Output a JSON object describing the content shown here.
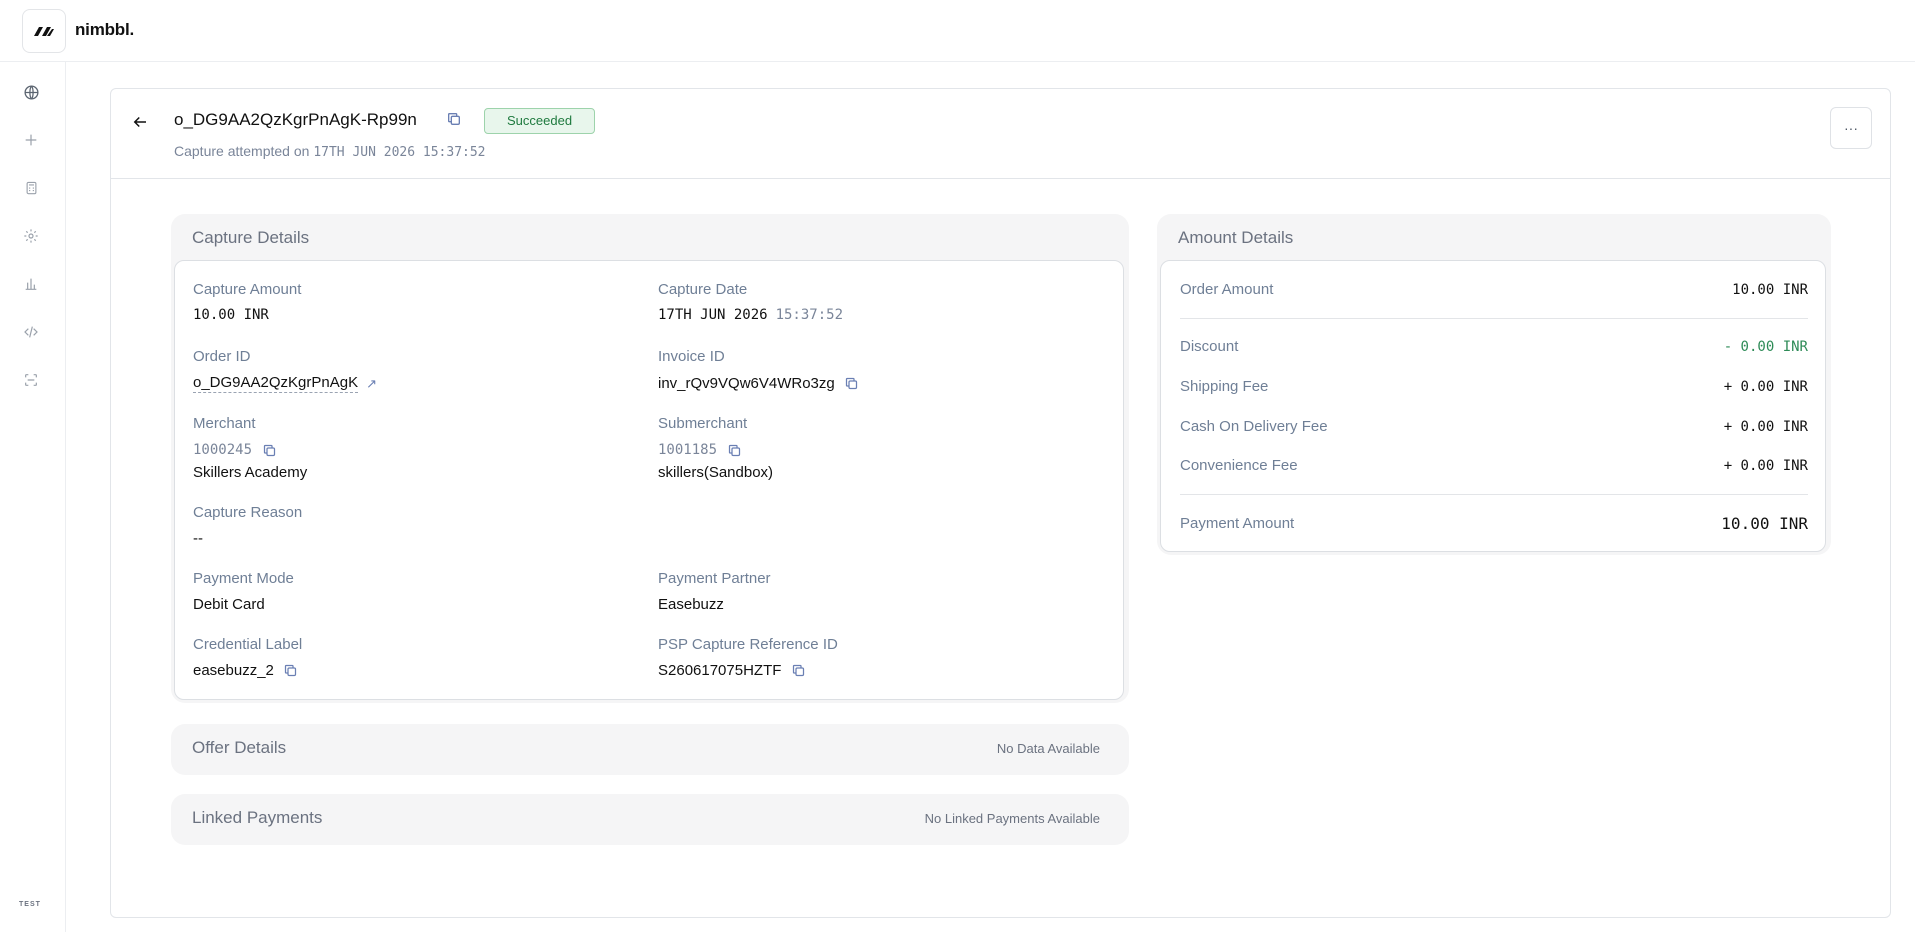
{
  "app": {
    "name": "nimbbl.",
    "env_badge": "TEST"
  },
  "sidebar": {
    "items": [
      {
        "icon": "globe-icon"
      },
      {
        "icon": "plus-icon"
      },
      {
        "icon": "calculator-icon"
      },
      {
        "icon": "settings-gear-icon"
      },
      {
        "icon": "bar-chart-icon"
      },
      {
        "icon": "code-icon"
      },
      {
        "icon": "scan-icon"
      }
    ]
  },
  "header": {
    "order_id": "o_DG9AA2QzKgrPnAgK-Rp99n",
    "status": "Succeeded",
    "subtitle_prefix": "Capture attempted on",
    "subtitle_date": "17TH JUN 2026 15:37:52",
    "more_label": "···"
  },
  "capture_details": {
    "title": "Capture Details",
    "capture_amount_label": "Capture Amount",
    "capture_amount": "10.00 INR",
    "capture_date_label": "Capture Date",
    "capture_date": "17TH JUN 2026",
    "capture_time": "15:37:52",
    "order_id_label": "Order ID",
    "order_id": "o_DG9AA2QzKgrPnAgK",
    "invoice_id_label": "Invoice ID",
    "invoice_id": "inv_rQv9VQw6V4WRo3zg",
    "merchant_label": "Merchant",
    "merchant_id": "1000245",
    "merchant_name": "Skillers Academy",
    "submerchant_label": "Submerchant",
    "submerchant_id": "1001185",
    "submerchant_name": "skillers(Sandbox)",
    "capture_reason_label": "Capture Reason",
    "capture_reason": "--",
    "payment_mode_label": "Payment Mode",
    "payment_mode": "Debit Card",
    "payment_partner_label": "Payment Partner",
    "payment_partner": "Easebuzz",
    "credential_label_label": "Credential Label",
    "credential_label": "easebuzz_2",
    "psp_ref_label": "PSP Capture Reference ID",
    "psp_ref": "S260617075HZTF"
  },
  "amount_details": {
    "title": "Amount Details",
    "order_amount_label": "Order Amount",
    "order_amount": "10.00 INR",
    "discount_label": "Discount",
    "discount": "- 0.00 INR",
    "shipping_label": "Shipping Fee",
    "shipping": "+ 0.00 INR",
    "cod_label": "Cash On Delivery Fee",
    "cod": "+ 0.00 INR",
    "convenience_label": "Convenience Fee",
    "convenience": "+ 0.00 INR",
    "payment_amount_label": "Payment Amount",
    "payment_amount": "10.00 INR"
  },
  "offer_details": {
    "title": "Offer Details",
    "empty": "No Data Available"
  },
  "linked_payments": {
    "title": "Linked Payments",
    "empty": "No Linked Payments Available"
  },
  "colors": {
    "accent": "#6a7fb3",
    "success_bg": "#e8f6ec",
    "success_fg": "#1f7a3f",
    "discount": "#2e8b57"
  }
}
